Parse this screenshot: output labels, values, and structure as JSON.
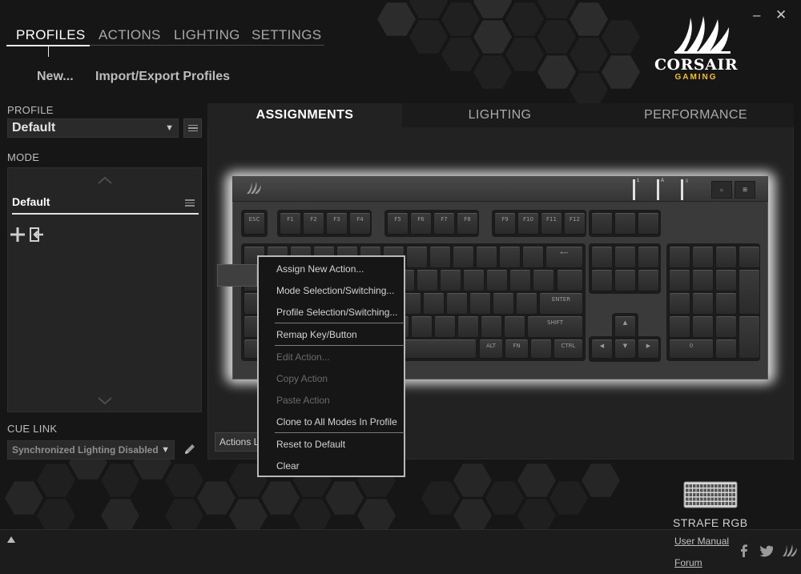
{
  "nav": {
    "tabs": [
      {
        "label": "PROFILES",
        "active": true
      },
      {
        "label": "ACTIONS",
        "active": false
      },
      {
        "label": "LIGHTING",
        "active": false
      },
      {
        "label": "SETTINGS",
        "active": false
      }
    ],
    "new_label": "New...",
    "import_export_label": "Import/Export Profiles"
  },
  "window": {
    "minimize": "–",
    "close": "✕"
  },
  "brand": {
    "name": "CORSAIR",
    "sub": "GAMING",
    "accent": "#f2c312"
  },
  "profile": {
    "label": "PROFILE",
    "selected": "Default"
  },
  "mode": {
    "label": "MODE",
    "items": [
      "Default"
    ]
  },
  "cue_link": {
    "label": "CUE LINK",
    "selected": "Synchronized Lighting Disabled"
  },
  "main_tabs": [
    {
      "label": "ASSIGNMENTS",
      "active": true
    },
    {
      "label": "LIGHTING",
      "active": false
    },
    {
      "label": "PERFORMANCE",
      "active": false
    }
  ],
  "keyboard": {
    "row_fn": [
      "ESC",
      "F1",
      "F2",
      "F3",
      "F4",
      "F5",
      "F6",
      "F7",
      "F8",
      "F9",
      "F10",
      "F11",
      "F12"
    ],
    "visible_labels": {
      "enter": "ENTER",
      "shift": "SHIFT",
      "alt": "ALT",
      "fn": "FN",
      "ctrl": "CTRL",
      "num0": "0"
    },
    "lock_indicators": [
      "1",
      "A",
      "⇩"
    ]
  },
  "actions_button_label": "Actions L",
  "context_menu": {
    "items": [
      {
        "label": "Assign New Action...",
        "enabled": true
      },
      {
        "label": "Mode Selection/Switching...",
        "enabled": true
      },
      {
        "label": "Profile Selection/Switching...",
        "enabled": true
      },
      {
        "label": "Remap Key/Button",
        "enabled": true
      },
      {
        "label": "Edit Action...",
        "enabled": false
      },
      {
        "label": "Copy Action",
        "enabled": false
      },
      {
        "label": "Paste Action",
        "enabled": false
      },
      {
        "label": "Clone to All Modes In Profile",
        "enabled": true
      },
      {
        "label": "Reset to Default",
        "enabled": true
      },
      {
        "label": "Clear",
        "enabled": true
      }
    ]
  },
  "device": {
    "name": "STRAFE RGB"
  },
  "links": {
    "manual": "User Manual",
    "forum": "Forum"
  },
  "icons": [
    "plus-icon",
    "import-icon",
    "pencil-icon",
    "facebook-icon",
    "twitter-icon",
    "corsair-icon",
    "keyboard-icon",
    "chevron-up-icon",
    "chevron-down-icon",
    "triangle-up-icon"
  ]
}
